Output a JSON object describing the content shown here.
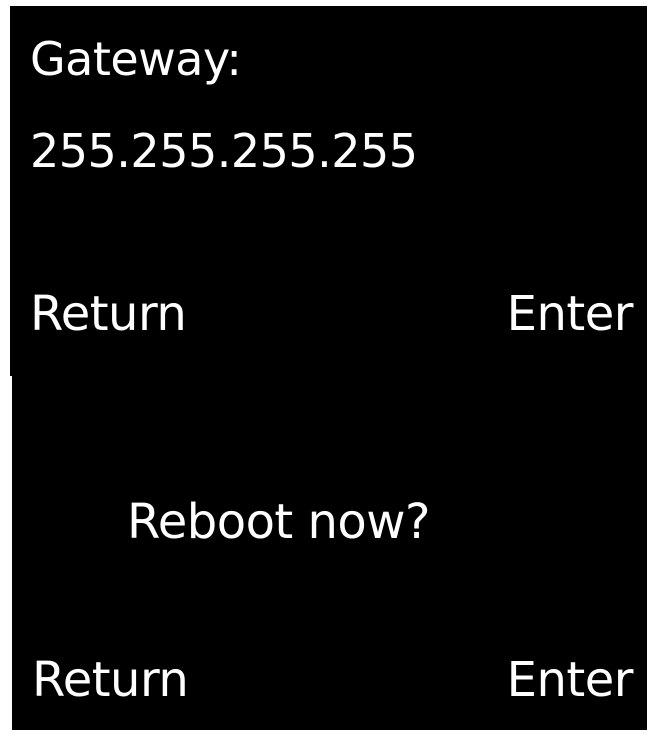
{
  "gateway_screen": {
    "label": "Gateway:",
    "value": "255.255.255.255",
    "return_label": "Return",
    "enter_label": "Enter"
  },
  "reboot_screen": {
    "prompt": "Reboot now?",
    "return_label": "Return",
    "enter_label": "Enter"
  },
  "colors": {
    "screen_background": "#000000",
    "text": "#ffffff",
    "page_background": "#ffffff"
  }
}
